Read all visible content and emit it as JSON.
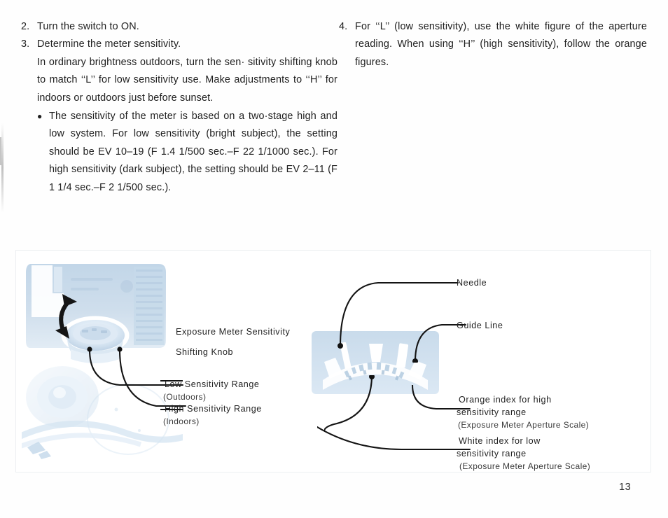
{
  "document": {
    "page_number": "13",
    "ink_color": "#202020",
    "photo_tint": "#b8cee2"
  },
  "left_column": {
    "steps": [
      {
        "number": "2.",
        "text": "Turn the switch to ON."
      },
      {
        "number": "3.",
        "text": "Determine the meter sensitivity."
      }
    ],
    "step3_paragraph": "In ordinary brightness outdoors, turn the sen· sitivity shifting knob to match ‘‘L’’ for low sensitivity use.  Make adjustments to ‘‘H’’ for indoors or outdoors just before sunset.",
    "bullet": {
      "marker": "●",
      "text": "The sensitivity of the meter is based on a two·stage high and low system.  For low sensitivity (bright subject), the setting should be EV 10–19 (F 1.4  1/500 sec.–F 22  1/1000 sec.).   For high sensitivity (dark subject), the setting should be EV 2–11 (F 1  1/4 sec.–F 2 1/500 sec.)."
    }
  },
  "right_column": {
    "steps": [
      {
        "number": "4.",
        "text": "For ‘‘L’’ (low sensitivity), use the white figure of the aperture reading. When using ‘‘H’’ (high sensitivity), follow the orange figures."
      }
    ]
  },
  "figure": {
    "labels": {
      "knob_line1": "Exposure Meter Sensitivity",
      "knob_line2": "Shifting Knob",
      "low_range_line1": "Low Sensitivity Range",
      "low_range_line2": "(Outdoors)",
      "high_range_line1": "High Sensitivity Range",
      "high_range_line2": "(Indoors)",
      "needle": "Needle",
      "guide_line": "Guide Line",
      "orange_index_line1": "Orange index for high",
      "orange_index_line2": "sensitivity range",
      "orange_index_line3": "(Exposure Meter Aperture Scale)",
      "white_index_line1": "White index for low",
      "white_index_line2": "sensitivity range",
      "white_index_line3": "(Exposure Meter Aperture Scale)"
    }
  }
}
